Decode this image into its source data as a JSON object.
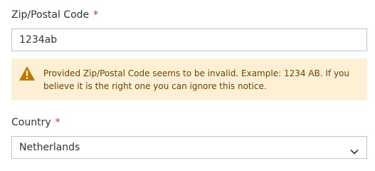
{
  "zip_field": {
    "label": "Zip/Postal Code",
    "required_mark": "*",
    "value": "1234ab"
  },
  "notice": {
    "icon": "warning-icon",
    "text": "Provided Zip/Postal Code seems to be invalid. Example: 1234 AB. If you believe it is the right one you can ignore this notice."
  },
  "country_field": {
    "label": "Country",
    "required_mark": "*",
    "selected": "Netherlands",
    "arrow_icon": "chevron-down-icon"
  },
  "colors": {
    "required": "#e02b27",
    "notice_bg": "#fdf0d5",
    "notice_text": "#6f4400",
    "warning_icon": "#c07600",
    "border": "#c2c2c2"
  }
}
